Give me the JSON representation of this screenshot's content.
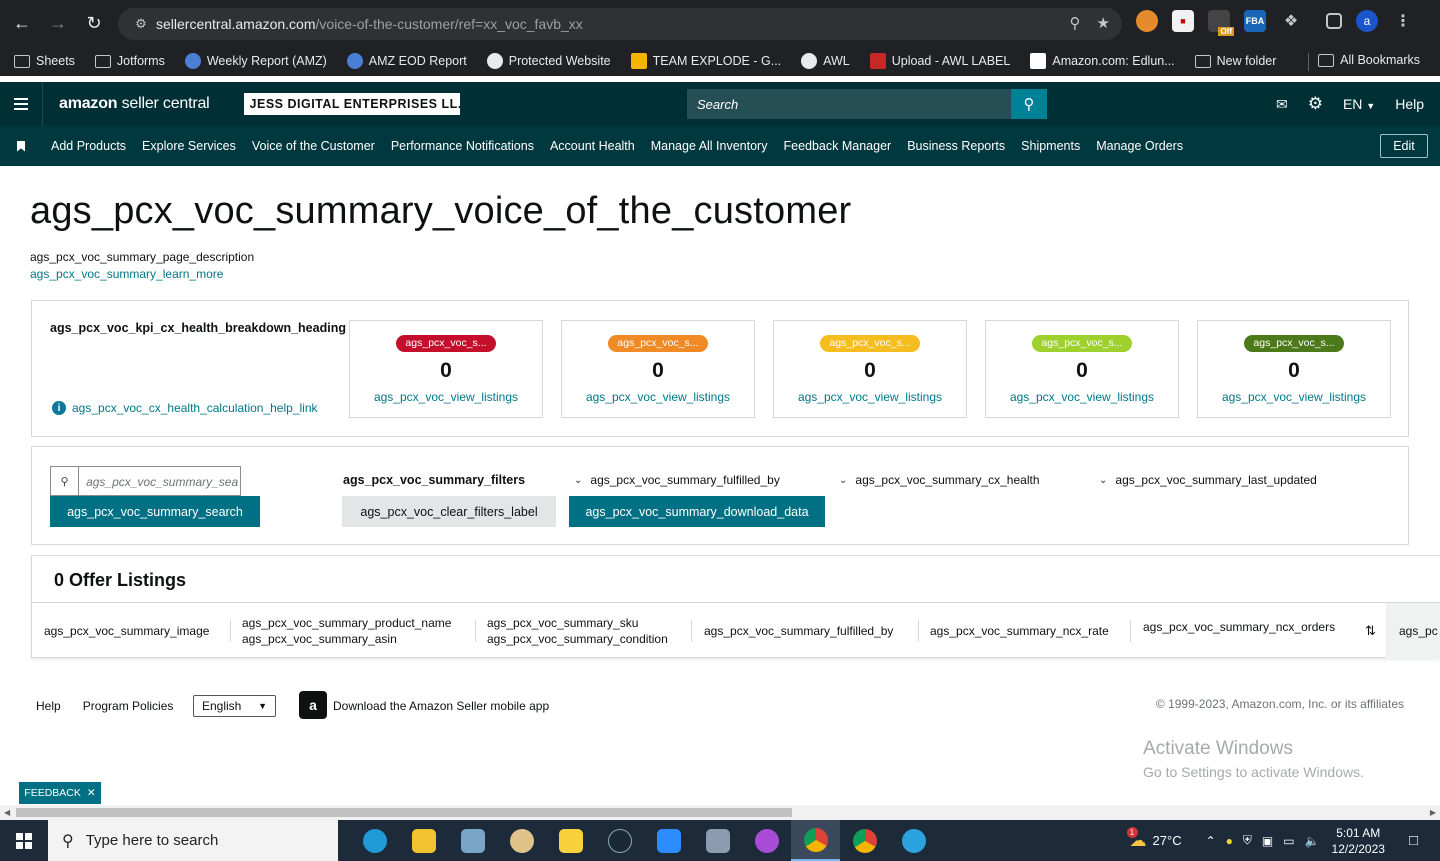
{
  "browser": {
    "url_host": "sellercentral.amazon.com",
    "url_path": "/voice-of-the-customer/ref=xx_voc_favb_xx",
    "profile_initial": "a",
    "ext_badge": "Off",
    "ext_fba": "FBA",
    "bookmarks": [
      {
        "label": "Sheets",
        "icon": "folder-icon"
      },
      {
        "label": "Jotforms",
        "icon": "folder-icon"
      },
      {
        "label": "Weekly Report (AMZ)",
        "icon": "app-icon"
      },
      {
        "label": "AMZ EOD Report",
        "icon": "app-icon"
      },
      {
        "label": "Protected Website",
        "icon": "globe-icon"
      },
      {
        "label": "TEAM EXPLODE - G...",
        "icon": "drive-icon"
      },
      {
        "label": "AWL",
        "icon": "globe-icon"
      },
      {
        "label": "Upload - AWL LABEL",
        "icon": "app-icon"
      },
      {
        "label": "Amazon.com: Edlun...",
        "icon": "amazon-icon"
      },
      {
        "label": "New folder",
        "icon": "folder-icon"
      }
    ],
    "all_bookmarks": "All Bookmarks"
  },
  "header": {
    "logo_bold": "amazon",
    "logo_rest": " seller central",
    "account": "JESS DIGITAL ENTERPRISES LL...",
    "search_placeholder": "Search",
    "lang": "EN",
    "help": "Help"
  },
  "nav": {
    "items": [
      "Add Products",
      "Explore Services",
      "Voice of the Customer",
      "Performance Notifications",
      "Account Health",
      "Manage All Inventory",
      "Feedback Manager",
      "Business Reports",
      "Shipments",
      "Manage Orders"
    ],
    "edit": "Edit"
  },
  "page": {
    "title": "ags_pcx_voc_summary_voice_of_the_customer",
    "description": "ags_pcx_voc_summary_page_description",
    "learn_more": "ags_pcx_voc_summary_learn_more"
  },
  "kpi": {
    "heading": "ags_pcx_voc_kpi_cx_health_breakdown_heading",
    "help_link": "ags_pcx_voc_cx_health_calculation_help_link",
    "cards": [
      {
        "pill": "ags_pcx_voc_s...",
        "value": "0",
        "link": "ags_pcx_voc_view_listings",
        "color": "#c40f2c"
      },
      {
        "pill": "ags_pcx_voc_s...",
        "value": "0",
        "link": "ags_pcx_voc_view_listings",
        "color": "#f08a24"
      },
      {
        "pill": "ags_pcx_voc_s...",
        "value": "0",
        "link": "ags_pcx_voc_view_listings",
        "color": "#f5bd1f"
      },
      {
        "pill": "ags_pcx_voc_s...",
        "value": "0",
        "link": "ags_pcx_voc_view_listings",
        "color": "#9ed02e"
      },
      {
        "pill": "ags_pcx_voc_s...",
        "value": "0",
        "link": "ags_pcx_voc_view_listings",
        "color": "#4c7a1a"
      }
    ]
  },
  "filters": {
    "search_placeholder": "ags_pcx_voc_summary_sea",
    "search_button": "ags_pcx_voc_summary_search",
    "filters_label": "ags_pcx_voc_summary_filters",
    "clear_filters": "ags_pcx_voc_clear_filters_label",
    "download": "ags_pcx_voc_summary_download_data",
    "dropdowns": [
      "ags_pcx_voc_summary_fulfilled_by",
      "ags_pcx_voc_summary_cx_health",
      "ags_pcx_voc_summary_last_updated"
    ]
  },
  "listings": {
    "title": "0 Offer Listings",
    "columns": {
      "image": "ags_pcx_voc_summary_image",
      "product_name": "ags_pcx_voc_summary_product_name",
      "asin": "ags_pcx_voc_summary_asin",
      "sku": "ags_pcx_voc_summary_sku",
      "condition": "ags_pcx_voc_summary_condition",
      "fulfilled_by": "ags_pcx_voc_summary_fulfilled_by",
      "ncx_rate": "ags_pcx_voc_summary_ncx_rate",
      "ncx_orders": "ags_pcx_voc_summary_ncx_orders",
      "truncated": "ags_pc"
    }
  },
  "footer": {
    "help": "Help",
    "policies": "Program Policies",
    "language": "English",
    "app": "Download the Amazon Seller mobile app",
    "copyright": "© 1999-2023, Amazon.com, Inc. or its affiliates"
  },
  "watermark": {
    "line1": "Activate Windows",
    "line2": "Go to Settings to activate Windows."
  },
  "feedback": "FEEDBACK",
  "taskbar": {
    "search": "Type here to search",
    "temperature": "27°C",
    "time": "5:01 AM",
    "date": "12/2/2023",
    "weather_badge": "1"
  }
}
